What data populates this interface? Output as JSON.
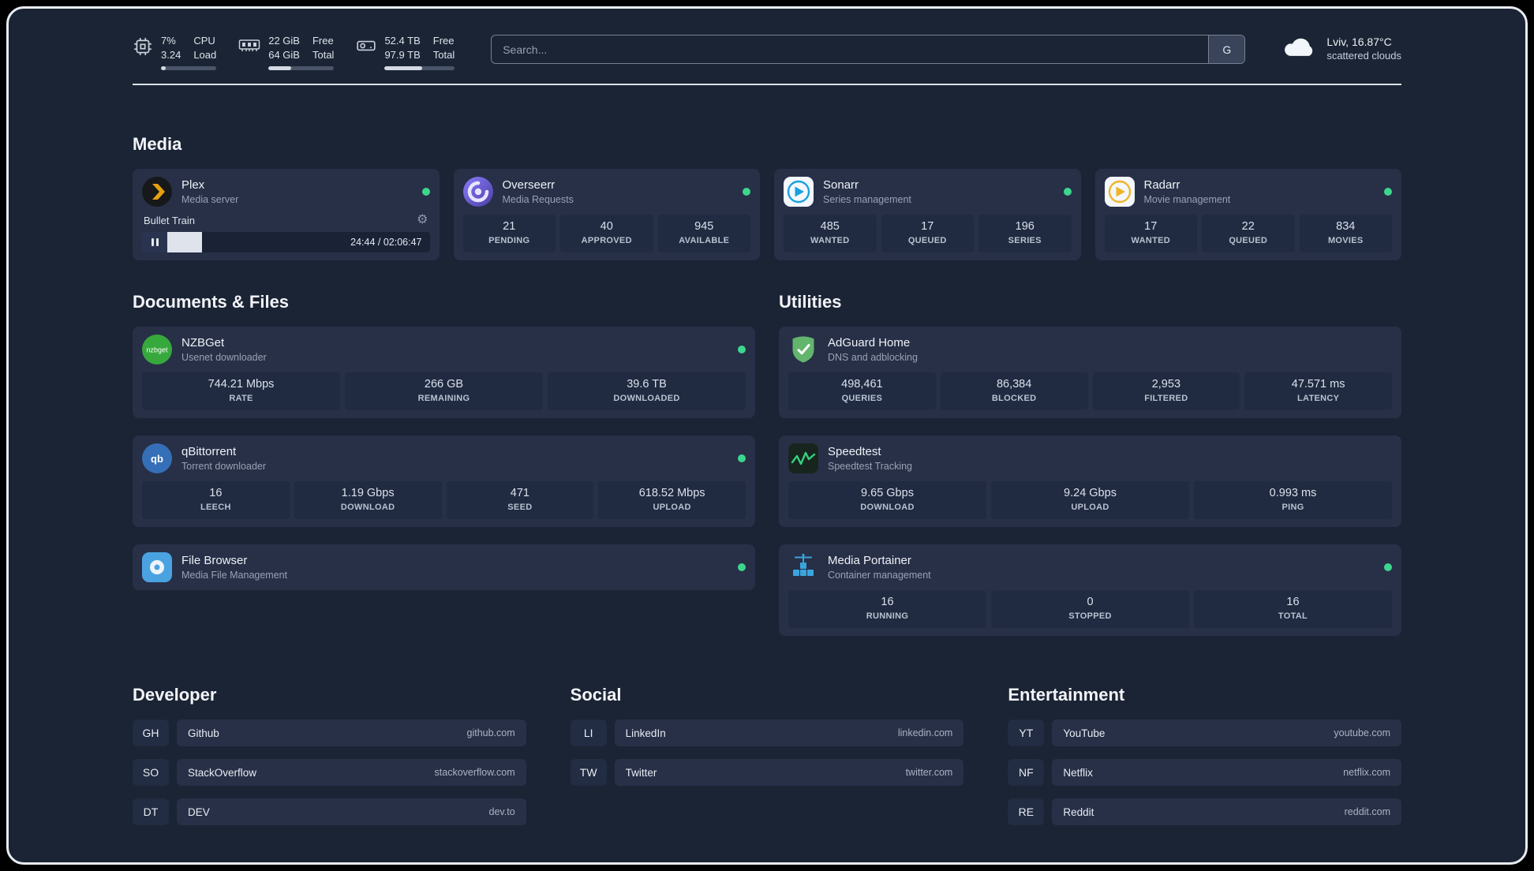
{
  "header": {
    "cpu": {
      "value_top": "7%",
      "value_bottom": "3.24",
      "label_top": "CPU",
      "label_bottom": "Load",
      "percent": 8
    },
    "memory": {
      "value_top": "22 GiB",
      "value_bottom": "64 GiB",
      "label_top": "Free",
      "label_bottom": "Total",
      "percent": 34
    },
    "disk": {
      "value_top": "52.4 TB",
      "value_bottom": "97.9 TB",
      "label_top": "Free",
      "label_bottom": "Total",
      "percent": 54
    },
    "search": {
      "placeholder": "Search...",
      "provider_label": "G"
    },
    "weather": {
      "location": "Lviv, 16.87°C",
      "condition": "scattered clouds"
    }
  },
  "sections": {
    "media": {
      "title": "Media",
      "plex": {
        "name": "Plex",
        "subtitle": "Media server",
        "now_playing": "Bullet Train",
        "time": "24:44 / 02:06:47",
        "progress_percent": 19.5
      },
      "overseerr": {
        "name": "Overseerr",
        "subtitle": "Media Requests",
        "stats": [
          {
            "value": "21",
            "label": "PENDING"
          },
          {
            "value": "40",
            "label": "APPROVED"
          },
          {
            "value": "945",
            "label": "AVAILABLE"
          }
        ]
      },
      "sonarr": {
        "name": "Sonarr",
        "subtitle": "Series management",
        "stats": [
          {
            "value": "485",
            "label": "WANTED"
          },
          {
            "value": "17",
            "label": "QUEUED"
          },
          {
            "value": "196",
            "label": "SERIES"
          }
        ]
      },
      "radarr": {
        "name": "Radarr",
        "subtitle": "Movie management",
        "stats": [
          {
            "value": "17",
            "label": "WANTED"
          },
          {
            "value": "22",
            "label": "QUEUED"
          },
          {
            "value": "834",
            "label": "MOVIES"
          }
        ]
      }
    },
    "documents": {
      "title": "Documents & Files",
      "nzbget": {
        "name": "NZBGet",
        "subtitle": "Usenet downloader",
        "stats": [
          {
            "value": "744.21 Mbps",
            "label": "RATE"
          },
          {
            "value": "266 GB",
            "label": "REMAINING"
          },
          {
            "value": "39.6 TB",
            "label": "DOWNLOADED"
          }
        ]
      },
      "qbittorrent": {
        "name": "qBittorrent",
        "subtitle": "Torrent downloader",
        "stats": [
          {
            "value": "16",
            "label": "LEECH"
          },
          {
            "value": "1.19 Gbps",
            "label": "DOWNLOAD"
          },
          {
            "value": "471",
            "label": "SEED"
          },
          {
            "value": "618.52 Mbps",
            "label": "UPLOAD"
          }
        ]
      },
      "filebrowser": {
        "name": "File Browser",
        "subtitle": "Media File Management"
      }
    },
    "utilities": {
      "title": "Utilities",
      "adguard": {
        "name": "AdGuard Home",
        "subtitle": "DNS and adblocking",
        "stats": [
          {
            "value": "498,461",
            "label": "QUERIES"
          },
          {
            "value": "86,384",
            "label": "BLOCKED"
          },
          {
            "value": "2,953",
            "label": "FILTERED"
          },
          {
            "value": "47.571 ms",
            "label": "LATENCY"
          }
        ]
      },
      "speedtest": {
        "name": "Speedtest",
        "subtitle": "Speedtest Tracking",
        "stats": [
          {
            "value": "9.65 Gbps",
            "label": "DOWNLOAD"
          },
          {
            "value": "9.24 Gbps",
            "label": "UPLOAD"
          },
          {
            "value": "0.993 ms",
            "label": "PING"
          }
        ]
      },
      "portainer": {
        "name": "Media Portainer",
        "subtitle": "Container management",
        "stats": [
          {
            "value": "16",
            "label": "RUNNING"
          },
          {
            "value": "0",
            "label": "STOPPED"
          },
          {
            "value": "16",
            "label": "TOTAL"
          }
        ]
      }
    },
    "bookmarks": {
      "developer": {
        "title": "Developer",
        "items": [
          {
            "abbr": "GH",
            "name": "Github",
            "host": "github.com"
          },
          {
            "abbr": "SO",
            "name": "StackOverflow",
            "host": "stackoverflow.com"
          },
          {
            "abbr": "DT",
            "name": "DEV",
            "host": "dev.to"
          }
        ]
      },
      "social": {
        "title": "Social",
        "items": [
          {
            "abbr": "LI",
            "name": "LinkedIn",
            "host": "linkedin.com"
          },
          {
            "abbr": "TW",
            "name": "Twitter",
            "host": "twitter.com"
          }
        ]
      },
      "entertainment": {
        "title": "Entertainment",
        "items": [
          {
            "abbr": "YT",
            "name": "YouTube",
            "host": "youtube.com"
          },
          {
            "abbr": "NF",
            "name": "Netflix",
            "host": "netflix.com"
          },
          {
            "abbr": "RE",
            "name": "Reddit",
            "host": "reddit.com"
          }
        ]
      }
    }
  },
  "colors": {
    "status_online": "#3cd68d",
    "background": "#1b2434",
    "card": "#273047",
    "plex_accent": "#e5a00d"
  }
}
